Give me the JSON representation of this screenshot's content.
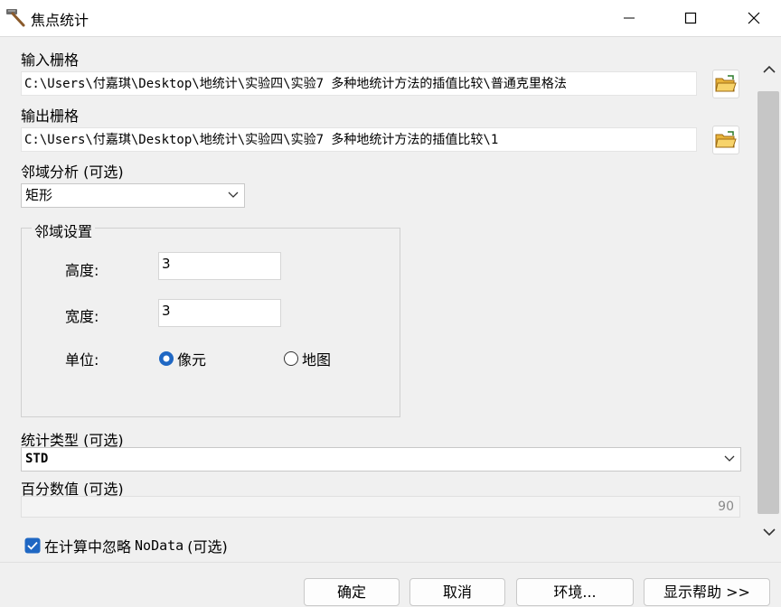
{
  "window": {
    "title": "焦点统计",
    "icon": "hammer-icon"
  },
  "input_raster": {
    "label": "输入栅格",
    "value": "C:\\Users\\付嘉琪\\Desktop\\地统计\\实验四\\实验7 多种地统计方法的插值比较\\普通克里格法"
  },
  "output_raster": {
    "label": "输出栅格",
    "value": "C:\\Users\\付嘉琪\\Desktop\\地统计\\实验四\\实验7 多种地统计方法的插值比较\\1"
  },
  "neighborhood": {
    "label": "邻域分析 (可选)",
    "selected": "矩形"
  },
  "neighborhood_settings": {
    "legend": "邻域设置",
    "height_label": "高度:",
    "height_value": "3",
    "width_label": "宽度:",
    "width_value": "3",
    "unit_label": "单位:",
    "unit_options": [
      {
        "label": "像元",
        "selected": true
      },
      {
        "label": "地图",
        "selected": false
      }
    ]
  },
  "statistics_type": {
    "label": "统计类型 (可选)",
    "selected": "STD"
  },
  "percentile": {
    "label": "百分数值 (可选)",
    "value": "90"
  },
  "ignore_nodata": {
    "label_prefix": "在计算中忽略",
    "label_nodata": " NoData",
    "label_suffix": " (可选)",
    "checked": true
  },
  "buttons": {
    "ok": "确定",
    "cancel": "取消",
    "environments": "环境...",
    "show_help": "显示帮助 >>"
  },
  "colors": {
    "accent": "#1f67c3",
    "folder": "#e8b33a"
  }
}
